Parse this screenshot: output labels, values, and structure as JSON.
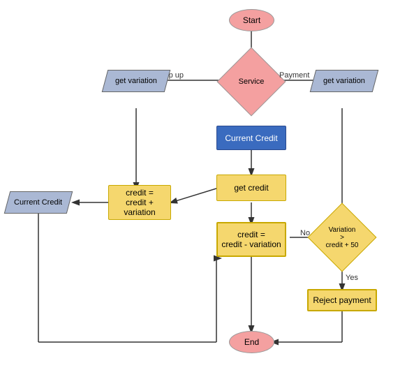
{
  "nodes": {
    "start": {
      "label": "Start"
    },
    "service": {
      "label": "Service"
    },
    "topup_label": {
      "label": "Top up"
    },
    "payment_label": {
      "label": "Payment"
    },
    "get_variation_left": {
      "label": "get variation"
    },
    "get_variation_right": {
      "label": "get variation"
    },
    "current_credit_blue": {
      "label": "Current Credit"
    },
    "get_credit": {
      "label": "get credit"
    },
    "credit_add": {
      "label": "credit =\ncredit + variation"
    },
    "current_credit_left": {
      "label": "Current Credit"
    },
    "credit_sub": {
      "label": "credit =\ncredit - variation"
    },
    "variation_diamond": {
      "label": "Variation\n>\ncredit + 50"
    },
    "reject_payment": {
      "label": "Reject payment"
    },
    "no_label": {
      "label": "No"
    },
    "yes_label": {
      "label": "Yes"
    },
    "end": {
      "label": "End"
    }
  }
}
